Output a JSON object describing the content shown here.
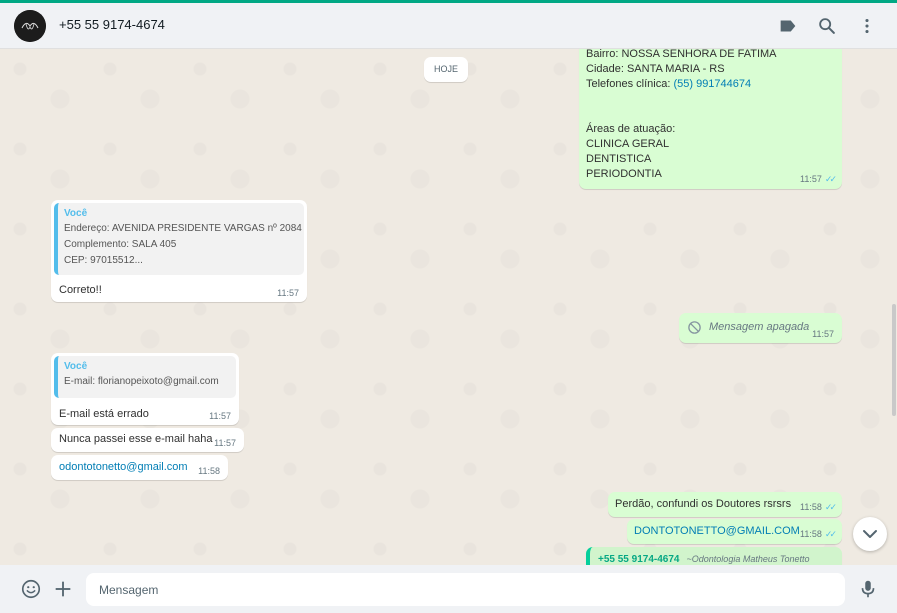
{
  "header": {
    "contact_name": "+55 55 9174-4674",
    "icons": [
      "label-icon",
      "search-icon",
      "menu-icon"
    ]
  },
  "chat": {
    "date_chip": "HOJE",
    "messages": [
      {
        "direction": "out",
        "lines": [
          "Bairro: NOSSA SENHORA DE FATIMA",
          "Cidade: SANTA MARIA - RS",
          "Telefones clínica:",
          "(55) 991744674",
          "Áreas de atuação:",
          "CLINICA GERAL",
          "DENTISTICA",
          "PERIODONTIA"
        ],
        "time": "11:57",
        "ticks": "✓✓"
      },
      {
        "direction": "in",
        "quote_author": "Você",
        "quote_lines": [
          "Endereço: AVENIDA PRESIDENTE VARGAS nº 2084",
          "Complemento: SALA 405",
          "CEP: 97015512..."
        ],
        "text": "Correto!!",
        "time": "11:57"
      },
      {
        "direction": "out",
        "text": "Mensagem apagada",
        "time": "11:57",
        "deleted": true
      },
      {
        "direction": "in",
        "quote_author": "Você",
        "quote_lines": [
          "E-mail: florianopeixoto@gmail.com"
        ],
        "text": "E-mail está errado",
        "time": "11:57"
      },
      {
        "direction": "in",
        "text": "Nunca passei esse e-mail haha",
        "time": "11:57"
      },
      {
        "direction": "in",
        "text": "odontotonetto@gmail.com",
        "time": "11:58",
        "link": true
      },
      {
        "direction": "out",
        "text": "Perdão, confundi os Doutores rsrsrs",
        "time": "11:58",
        "ticks": "✓✓"
      },
      {
        "direction": "out",
        "text": "DONTOTONETTO@GMAIL.COM",
        "time": "11:58",
        "ticks": "✓✓",
        "link": true
      },
      {
        "direction": "out",
        "quote_author": "+55 55 9174-4674",
        "quote_subtitle": "~Odontologia Matheus Tonetto"
      }
    ]
  },
  "footer": {
    "input_placeholder": "Mensagem",
    "icons": [
      "emoji-icon",
      "attach-plus-icon",
      "microphone-icon"
    ]
  },
  "colors": {
    "accent": "#00a884",
    "outgoing_bubble": "#d9fdd3",
    "incoming_bubble": "#ffffff",
    "chat_background": "#efeae2",
    "link": "#027eb5",
    "read_ticks": "#53bdeb"
  }
}
